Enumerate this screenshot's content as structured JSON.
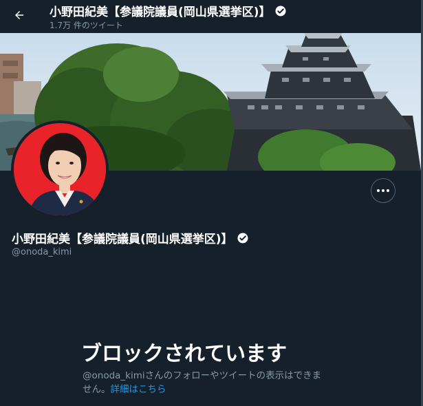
{
  "header": {
    "back_icon": "arrow-left-icon",
    "title": "小野田紀美【参議院議員(岡山県選挙区)】",
    "tweet_count": "1.7万 件のツイート",
    "verified_icon": "verified-badge-icon"
  },
  "profile": {
    "name": "小野田紀美【参議院議員(岡山県選挙区)】",
    "handle": "@onoda_kimi",
    "more_icon": "more-options-icon"
  },
  "blocked": {
    "title": "ブロックされています",
    "message": "@onoda_kimiさんのフォローやツイートの表示はできません。",
    "link": "詳細はこちら"
  },
  "colors": {
    "background": "#15202b",
    "secondary_text": "#8899a6",
    "link": "#1d9bf0",
    "avatar_bg": "#e8232a"
  }
}
